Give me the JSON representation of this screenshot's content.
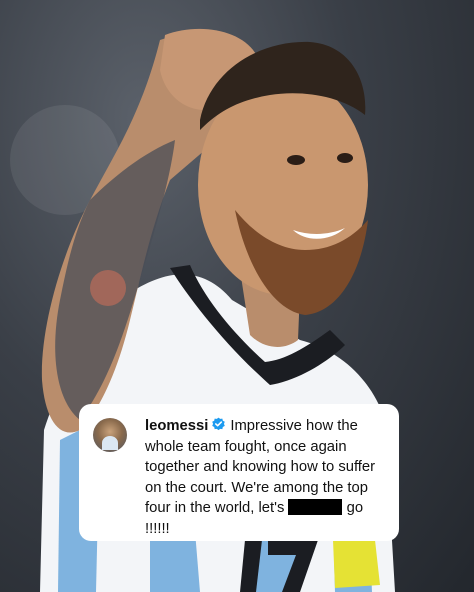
{
  "post": {
    "username": "leomessi",
    "caption_line1": "Impressive how the",
    "caption_line2": "whole team fought, once again",
    "caption_line3": "together and knowing how to suffer",
    "caption_line4": "on the court. We're among the top",
    "caption_line5_pre": "four in the world, let's",
    "caption_line5_post": "go",
    "caption_line6": "!!!!!!"
  },
  "colors": {
    "verified_badge": "#1d9bf0",
    "card_background": "#ffffff",
    "redaction": "#000000"
  },
  "icons": {
    "verified": "verified-badge-icon",
    "avatar": "profile-avatar"
  }
}
